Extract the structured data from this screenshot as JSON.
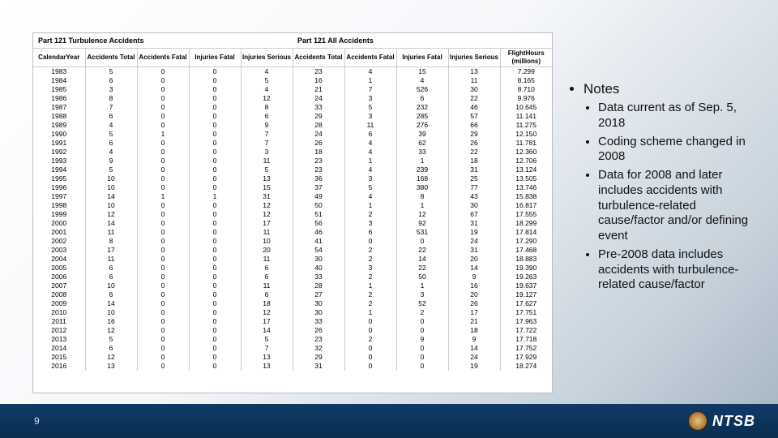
{
  "table": {
    "section1_title": "Part 121 Turbulence Accidents",
    "section2_title": "Part 121 All Accidents",
    "columns": [
      "CalendarYear",
      "Accidents Total",
      "Accidents Fatal",
      "Injuries Fatal",
      "Injuries Serious",
      "Accidents Total",
      "Accidents Fatal",
      "Injuries Fatal",
      "Injuries Serious",
      "FlightHours (millions)"
    ],
    "rows": [
      [
        "1983",
        "5",
        "0",
        "0",
        "4",
        "23",
        "4",
        "15",
        "13",
        "7.299"
      ],
      [
        "1984",
        "6",
        "0",
        "0",
        "5",
        "16",
        "1",
        "4",
        "11",
        "8.165"
      ],
      [
        "1985",
        "3",
        "0",
        "0",
        "4",
        "21",
        "7",
        "526",
        "30",
        "8.710"
      ],
      [
        "1986",
        "8",
        "0",
        "0",
        "12",
        "24",
        "3",
        "6",
        "22",
        "9.976"
      ],
      [
        "1987",
        "7",
        "0",
        "0",
        "8",
        "33",
        "5",
        "232",
        "46",
        "10.645"
      ],
      [
        "1988",
        "6",
        "0",
        "0",
        "6",
        "29",
        "3",
        "285",
        "57",
        "11.141"
      ],
      [
        "1989",
        "4",
        "0",
        "0",
        "9",
        "28",
        "11",
        "276",
        "66",
        "11.275"
      ],
      [
        "1990",
        "5",
        "1",
        "0",
        "7",
        "24",
        "6",
        "39",
        "29",
        "12.150"
      ],
      [
        "1991",
        "6",
        "0",
        "0",
        "7",
        "26",
        "4",
        "62",
        "26",
        "11.781"
      ],
      [
        "1992",
        "4",
        "0",
        "0",
        "3",
        "18",
        "4",
        "33",
        "22",
        "12.360"
      ],
      [
        "1993",
        "9",
        "0",
        "0",
        "11",
        "23",
        "1",
        "1",
        "18",
        "12.706"
      ],
      [
        "1994",
        "5",
        "0",
        "0",
        "5",
        "23",
        "4",
        "239",
        "31",
        "13.124"
      ],
      [
        "1995",
        "10",
        "0",
        "0",
        "13",
        "36",
        "3",
        "168",
        "25",
        "13.505"
      ],
      [
        "1996",
        "10",
        "0",
        "0",
        "15",
        "37",
        "5",
        "380",
        "77",
        "13.746"
      ],
      [
        "1997",
        "14",
        "1",
        "1",
        "31",
        "49",
        "4",
        "8",
        "43",
        "15.838"
      ],
      [
        "1998",
        "10",
        "0",
        "0",
        "12",
        "50",
        "1",
        "1",
        "30",
        "16.817"
      ],
      [
        "1999",
        "12",
        "0",
        "0",
        "12",
        "51",
        "2",
        "12",
        "67",
        "17.555"
      ],
      [
        "2000",
        "14",
        "0",
        "0",
        "17",
        "56",
        "3",
        "92",
        "31",
        "18.299"
      ],
      [
        "2001",
        "11",
        "0",
        "0",
        "11",
        "46",
        "6",
        "531",
        "19",
        "17.814"
      ],
      [
        "2002",
        "8",
        "0",
        "0",
        "10",
        "41",
        "0",
        "0",
        "24",
        "17.290"
      ],
      [
        "2003",
        "17",
        "0",
        "0",
        "20",
        "54",
        "2",
        "22",
        "31",
        "17.468"
      ],
      [
        "2004",
        "11",
        "0",
        "0",
        "11",
        "30",
        "2",
        "14",
        "20",
        "18.883"
      ],
      [
        "2005",
        "6",
        "0",
        "0",
        "6",
        "40",
        "3",
        "22",
        "14",
        "19.390"
      ],
      [
        "2006",
        "6",
        "0",
        "0",
        "6",
        "33",
        "2",
        "50",
        "9",
        "19.263"
      ],
      [
        "2007",
        "10",
        "0",
        "0",
        "11",
        "28",
        "1",
        "1",
        "16",
        "19.637"
      ],
      [
        "2008",
        "6",
        "0",
        "0",
        "6",
        "27",
        "2",
        "3",
        "20",
        "19.127"
      ],
      [
        "2009",
        "14",
        "0",
        "0",
        "18",
        "30",
        "2",
        "52",
        "26",
        "17.627"
      ],
      [
        "2010",
        "10",
        "0",
        "0",
        "12",
        "30",
        "1",
        "2",
        "17",
        "17.751"
      ],
      [
        "2011",
        "16",
        "0",
        "0",
        "17",
        "33",
        "0",
        "0",
        "21",
        "17.963"
      ],
      [
        "2012",
        "12",
        "0",
        "0",
        "14",
        "26",
        "0",
        "0",
        "18",
        "17.722"
      ],
      [
        "2013",
        "5",
        "0",
        "0",
        "5",
        "23",
        "2",
        "9",
        "9",
        "17.718"
      ],
      [
        "2014",
        "6",
        "0",
        "0",
        "7",
        "32",
        "0",
        "0",
        "14",
        "17.752"
      ],
      [
        "2015",
        "12",
        "0",
        "0",
        "13",
        "29",
        "0",
        "0",
        "24",
        "17.929"
      ],
      [
        "2016",
        "13",
        "0",
        "0",
        "13",
        "31",
        "0",
        "0",
        "19",
        "18.274"
      ]
    ]
  },
  "notes": {
    "title": "Notes",
    "items": [
      "Data current as of Sep. 5, 2018",
      "Coding scheme changed in 2008",
      "Data for 2008 and later includes accidents with turbulence-related cause/factor and/or defining event",
      "Pre-2008 data includes accidents with turbulence-related cause/factor"
    ]
  },
  "slide_number": "9",
  "logo_text": "NTSB"
}
